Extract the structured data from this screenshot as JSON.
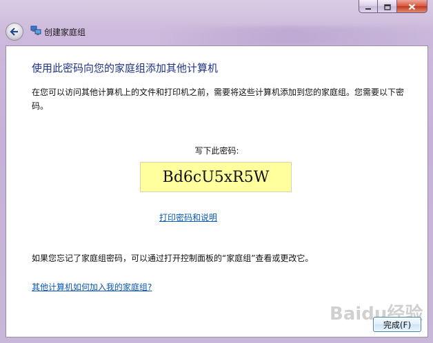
{
  "window": {
    "title": "创建家庭组",
    "title_icon": "homegroup-icon"
  },
  "titlebar": {
    "minimize_icon": "minimize-icon",
    "maximize_icon": "maximize-icon",
    "close_icon": "close-icon"
  },
  "nav": {
    "back_icon": "back-arrow-icon"
  },
  "main": {
    "heading": "使用此密码向您的家庭组添加其他计算机",
    "intro": "在您可以访问其他计算机上的文件和打印机之前，需要将这些计算机添加到您的家庭组。您需要以下密码。",
    "password_label": "写下此密码:",
    "password": "Bd6cU5xR5W",
    "print_link": "打印密码和说明",
    "forgot_text": "如果您忘记了家庭组密码，可以通过打开控制面板的“家庭组”查看或更改它。",
    "how_link": "其他计算机如何加入我的家庭组?"
  },
  "footer": {
    "finish_label": "完成(F)"
  },
  "watermark": "Baidu经验",
  "colors": {
    "heading": "#1e3287",
    "link": "#0a58b5",
    "password_bg": "#ffff9e",
    "close_button": "#c7432c"
  }
}
